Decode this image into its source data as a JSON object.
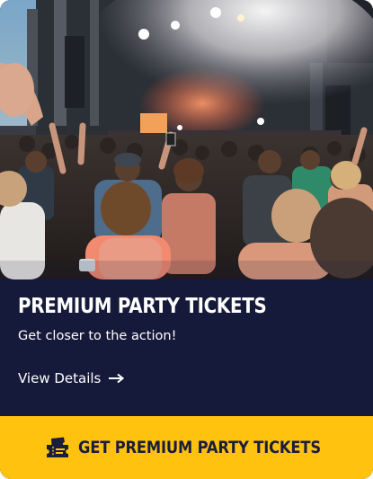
{
  "card": {
    "image_alt": "Concert crowd in front of a stage with lights and smoke",
    "title": "PREMIUM PARTY TICKETS",
    "subtitle": "Get closer to the action!",
    "details_link": {
      "label": "View Details",
      "icon": "arrow-right-icon"
    },
    "cta": {
      "label": "GET PREMIUM PARTY TICKETS",
      "icon": "tickets-icon"
    }
  },
  "colors": {
    "panel_background": "#161a3a",
    "cta_background": "#ffc20e",
    "cta_text": "#1a1d3c",
    "text_light": "#ffffff"
  }
}
